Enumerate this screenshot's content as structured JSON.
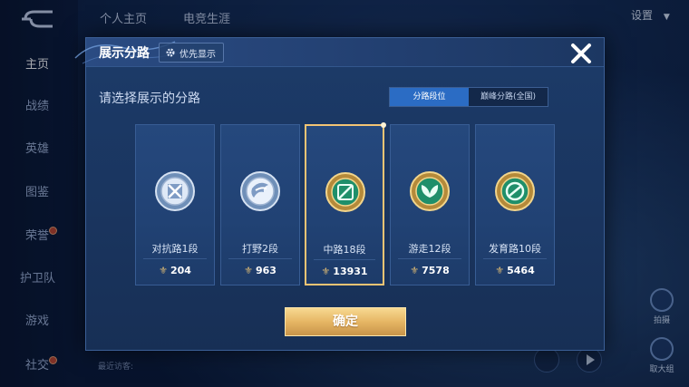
{
  "top_nav": {
    "tabs": [
      "个人主页",
      "电竞生涯"
    ],
    "settings_label": "设置"
  },
  "left_nav": {
    "items": [
      "主页",
      "战绩",
      "英雄",
      "图鉴",
      "荣誉",
      "护卫队",
      "游戏",
      "社交"
    ]
  },
  "background": {
    "visitors_label": "最近访客:",
    "right_buttons": [
      "拍摄",
      "取大组"
    ]
  },
  "dialog": {
    "title": "展示分路",
    "priority_label": "优先显示",
    "subtitle": "请选择展示的分路",
    "tabs": [
      {
        "label": "分路段位",
        "active": true
      },
      {
        "label": "巅峰分路(全国)",
        "active": false
      }
    ],
    "cards": [
      {
        "rank": "对抗路1段",
        "score": "204",
        "emblem": "sword-emblem-icon",
        "tier": "silver",
        "selected": false
      },
      {
        "rank": "打野2段",
        "score": "963",
        "emblem": "hook-emblem-icon",
        "tier": "silver",
        "selected": false
      },
      {
        "rank": "中路18段",
        "score": "13931",
        "emblem": "staff-emblem-icon",
        "tier": "gold",
        "selected": true
      },
      {
        "rank": "游走12段",
        "score": "7578",
        "emblem": "leaf-emblem-icon",
        "tier": "gold",
        "selected": false
      },
      {
        "rank": "发育路10段",
        "score": "5464",
        "emblem": "arrow-emblem-icon",
        "tier": "gold",
        "selected": false
      }
    ],
    "confirm_label": "确定"
  },
  "colors": {
    "tab_active": "#2b6cc4",
    "selected_border": "#f3c474",
    "confirm_gold": "#e6b664"
  }
}
